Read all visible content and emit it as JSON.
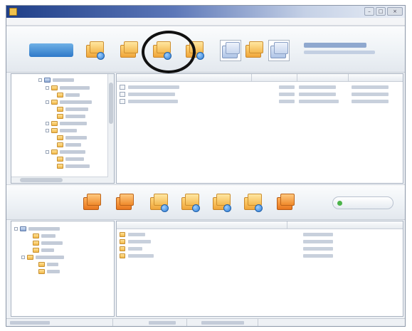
{
  "window": {
    "title": ""
  },
  "menubar": {
    "items": [
      "",
      "",
      "",
      ""
    ]
  },
  "top_toolbar": {
    "icons": [
      {
        "name": "folder-open-icon",
        "kind": "badge"
      },
      {
        "name": "folder-icon",
        "kind": "plain"
      },
      {
        "name": "folder-download-icon",
        "kind": "badge",
        "highlighted": true
      },
      {
        "name": "folder-upload-icon",
        "kind": "badge"
      },
      {
        "name": "split-pane-icon",
        "kind": "pane"
      },
      {
        "name": "folder-stack-icon",
        "kind": "plain"
      },
      {
        "name": "folder-list-icon",
        "kind": "pane"
      }
    ]
  },
  "middle_toolbar": {
    "icons": [
      {
        "name": "orange-folder-icon-1"
      },
      {
        "name": "orange-folder-icon-2"
      },
      {
        "name": "folder-transfer-icon"
      },
      {
        "name": "folder-sync-icon"
      },
      {
        "name": "folder-refresh-icon"
      },
      {
        "name": "folder-copy-icon"
      },
      {
        "name": "folder-move-icon"
      }
    ],
    "connect_label": ""
  },
  "top_tree": {
    "items": []
  },
  "top_list": {
    "columns": [
      "",
      "",
      "",
      ""
    ],
    "rows": [
      {
        "name": "",
        "size": "",
        "type": "",
        "modified": ""
      },
      {
        "name": "",
        "size": "",
        "type": "",
        "modified": ""
      },
      {
        "name": "",
        "size": "",
        "type": "",
        "modified": ""
      }
    ]
  },
  "bottom_tree": {
    "items": []
  },
  "bottom_list": {
    "columns": [
      "",
      ""
    ],
    "rows": [
      {
        "name": "",
        "type": ""
      },
      {
        "name": "",
        "type": ""
      },
      {
        "name": "",
        "type": ""
      },
      {
        "name": "",
        "type": ""
      }
    ]
  },
  "statusbar": {
    "segments": [
      "",
      "",
      "",
      ""
    ]
  }
}
